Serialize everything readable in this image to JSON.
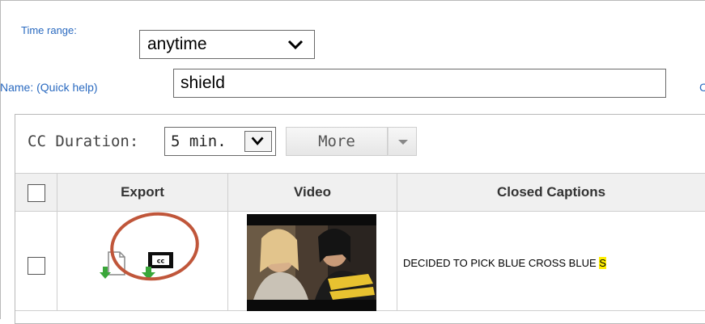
{
  "filters": {
    "time_range_label": "Time range:",
    "time_range_value": "anytime",
    "name_label": "Name:",
    "quick_help_link": "(Quick help)",
    "name_value": "shield",
    "right_partial_text": "C"
  },
  "toolbar": {
    "cc_duration_label": "CC Duration:",
    "cc_duration_value": "5 min.",
    "more_label": "More"
  },
  "table": {
    "columns": [
      "Export",
      "Video",
      "Closed Captions"
    ],
    "rows": [
      {
        "export_icons": [
          "download-document-icon",
          "download-cc-icon"
        ],
        "caption_text": "DECIDED TO PICK BLUE CROSS BLUE ",
        "caption_highlight": "S"
      }
    ]
  },
  "colors": {
    "link_blue": "#2a6ac0",
    "highlight": "#ffef00",
    "annotation_circle": "#c0563a",
    "download_arrow": "#3aa63a"
  }
}
